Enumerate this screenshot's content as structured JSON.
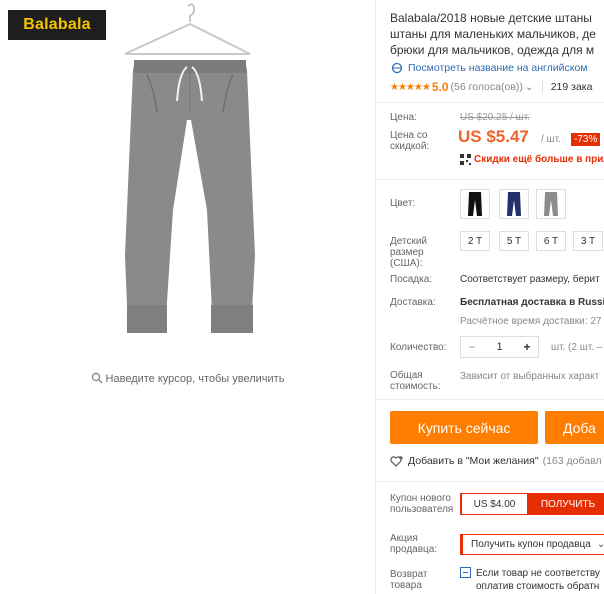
{
  "brand": {
    "logo_text": "Balabala"
  },
  "gallery": {
    "zoom_hint": "Наведите курсор, чтобы увеличить"
  },
  "product": {
    "title": "Balabala/2018 новые детские штаны\nштаны для маленьких мальчиков, де\nбрюки для мальчиков, одежда для м",
    "translate_link": "Посмотреть название на английском",
    "rating": {
      "stars": "★★★★★",
      "value": "5.0",
      "votes": "(56 голоса(ов))",
      "orders": "219 зака"
    }
  },
  "price": {
    "label": "Цена:",
    "old": "US $20.25 / шт.",
    "discount_label": "Цена со скидкой:",
    "new": "US $5.47",
    "per_unit": "/ шт.",
    "discount_badge": "-73%",
    "app_promo": "Скидки ещё больше в прил"
  },
  "options": {
    "color_label": "Цвет:",
    "colors": [
      "black",
      "navy",
      "gray"
    ],
    "size_label": "Детский размер (США):",
    "sizes": [
      "2 T",
      "5 T",
      "6 T",
      "3 T"
    ],
    "fit_label": "Посадка:",
    "fit_value": "Соответствует размеру, берит",
    "shipping_label": "Доставка:",
    "shipping_value": "Бесплатная доставка в Russi",
    "shipping_time": "Расчётное время доставки: 27",
    "quantity_label": "Количество:",
    "quantity_value": "1",
    "quantity_unit": "шт. (2 шт. –",
    "total_label": "Общая стоимость:",
    "total_value": "Зависит от выбранных характ"
  },
  "actions": {
    "buy_now": "Купить сейчас",
    "add_to_cart": "Доба",
    "wishlist": "Добавить в \"Мои желания\"",
    "wishlist_count": "(163 добавл"
  },
  "coupons": {
    "new_user_label": "Купон нового пользователя",
    "new_user_amount": "US $4.00",
    "new_user_get": "ПОЛУЧИТЬ",
    "seller_label": "Акция продавца:",
    "seller_button": "Получить купон продавца",
    "return_label": "Возврат товара",
    "return_text_1": "Если товар не соответству",
    "return_text_2": "оплатив стоимость обратн"
  },
  "colors": {
    "accent_orange": "#ff7e00",
    "price_red": "#f2632b",
    "badge_red": "#e62e04",
    "link_blue": "#2f6ab4",
    "logo_bg": "#1e1e1e",
    "logo_fg": "#f2c500"
  }
}
